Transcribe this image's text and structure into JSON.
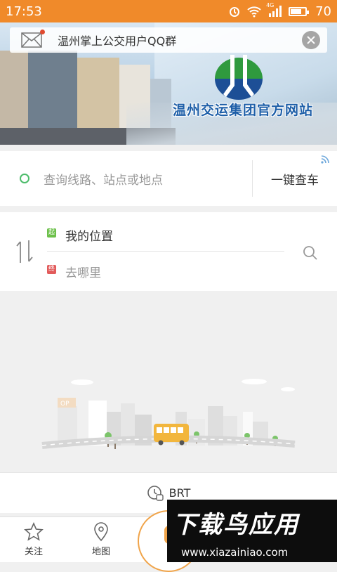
{
  "status_bar": {
    "time": "17:53",
    "signal_tag": "4G",
    "battery": "70"
  },
  "banner": {
    "title": "温州交运集团官方网站"
  },
  "notice": {
    "text": "温州掌上公交用户QQ群"
  },
  "search": {
    "placeholder": "查询线路、站点或地点",
    "quick_label": "一键查车"
  },
  "route": {
    "start_tag": "起",
    "end_tag": "终",
    "from": "我的位置",
    "to": "去哪里"
  },
  "illustration": {
    "sign": "OP"
  },
  "brt": {
    "label": "BRT"
  },
  "tabs": [
    {
      "label": "关注"
    },
    {
      "label": "地图"
    }
  ],
  "watermark": {
    "title": "下载鸟应用",
    "url": "www.xiazainiao.com"
  },
  "colors": {
    "accent": "#f08a2a",
    "green": "#4cbc6a",
    "red": "#e25b5b",
    "brand_blue": "#1e5fa8"
  }
}
